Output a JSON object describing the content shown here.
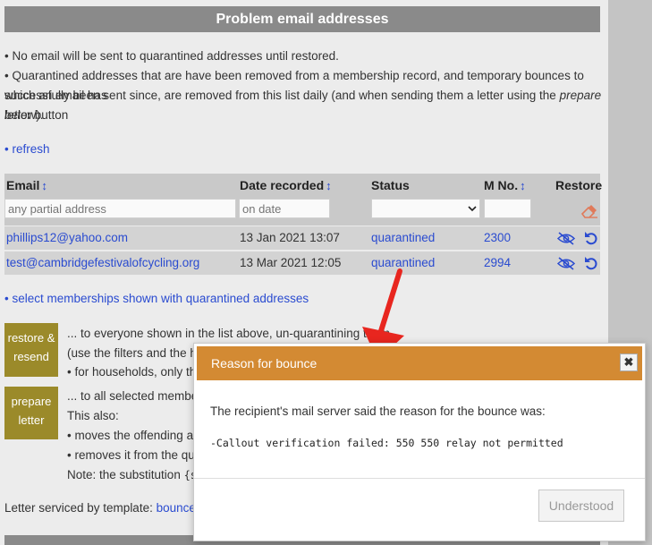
{
  "header": {
    "title": "Problem email addresses"
  },
  "info": {
    "line1": "• No email will be sent to quarantined addresses until restored.",
    "line2a": "• Quarantined addresses that are have been removed from a membership record, and temporary bounces to which an email has",
    "line2b_pre": "successfully been sent since, are removed from this list daily (and when sending them a letter using the ",
    "line2b_italic": "prepare letter",
    "line2b_post": " button",
    "line2c": "below).",
    "refresh": "• refresh"
  },
  "table": {
    "columns": {
      "email": "Email",
      "date": "Date recorded",
      "status": "Status",
      "mno": "M No.",
      "restore": "Restore"
    },
    "sort_glyph": "↕",
    "filters": {
      "email_placeholder": "any partial address",
      "date_placeholder": "on date",
      "status_value": ""
    },
    "rows": [
      {
        "email": "phillips12@yahoo.com",
        "date": "13 Jan 2021 13:07",
        "status": "quarantined",
        "mno": "2300"
      },
      {
        "email": "test@cambridgefestivalofcycling.org",
        "date": "13 Mar 2021 12:05",
        "status": "quarantined",
        "mno": "2994"
      }
    ]
  },
  "select_link": "• select memberships shown with quarantined addresses",
  "actions": {
    "restore_line1": "restore &",
    "restore_line2": "resend",
    "restore_desc1": "... to everyone shown in the list above, un-quarantining them",
    "restore_desc2": "(use the filters and the hide",
    "restore_desc3": "• for households, only the f",
    "prepare_line1": "prepare",
    "prepare_line2": "letter",
    "prepare_desc1": "... to all selected membersh",
    "prepare_desc2": "This also:",
    "prepare_desc3": "• moves the offending addr",
    "prepare_desc4": "• removes it from the quara",
    "prepare_desc5_pre": "Note: the substitution ",
    "prepare_desc5_code": "{sho"
  },
  "template": {
    "label": "Letter serviced by template: ",
    "link": "bounced em"
  },
  "dialog": {
    "title": "Reason for bounce",
    "close_glyph": "✖",
    "text": "The recipient's mail server said the reason for the bounce was:",
    "reason": "-Callout verification failed: 550 550 relay not permitted",
    "button": "Understood"
  },
  "colors": {
    "accent_orange": "#d38a33",
    "olive_button": "#9b8a2a",
    "link_blue": "#2a4bd0",
    "arrow_red": "#e8261f"
  }
}
